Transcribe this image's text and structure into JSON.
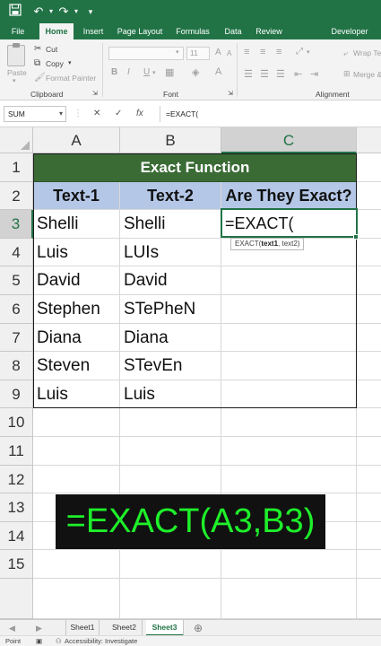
{
  "quick_access": {
    "save_icon": "save-icon",
    "undo_icon": "undo-icon",
    "redo_icon": "redo-icon"
  },
  "ribbon_tabs": [
    "File",
    "Home",
    "Insert",
    "Page Layout",
    "Formulas",
    "Data",
    "Review",
    "Developer"
  ],
  "active_tab": "Home",
  "ribbon": {
    "clipboard": {
      "paste": "Paste",
      "cut": "Cut",
      "copy": "Copy",
      "format_painter": "Format Painter",
      "label": "Clipboard"
    },
    "font": {
      "label": "Font",
      "size": "11",
      "bold": "B",
      "italic": "I",
      "underline": "U",
      "grow": "A",
      "shrink": "A"
    },
    "alignment": {
      "wrap_text": "Wrap Te",
      "merge": "Merge &",
      "label": "Alignment"
    }
  },
  "formula_bar": {
    "name_box": "SUM",
    "cancel": "✕",
    "enter": "✓",
    "fx": "fx",
    "formula": "=EXACT("
  },
  "columns": [
    "A",
    "B",
    "C"
  ],
  "rows": [
    "1",
    "2",
    "3",
    "4",
    "5",
    "6",
    "7",
    "8",
    "9",
    "10",
    "11",
    "12",
    "13",
    "14",
    "15"
  ],
  "title": "Exact Function",
  "headers": [
    "Text-1",
    "Text-2",
    "Are They Exact?"
  ],
  "data": [
    {
      "a": "Shelli",
      "b": "Shelli",
      "c": "=EXACT("
    },
    {
      "a": "Luis",
      "b": "LUIs",
      "c": ""
    },
    {
      "a": "David",
      "b": "David",
      "c": ""
    },
    {
      "a": "Stephen",
      "b": "STePheN",
      "c": ""
    },
    {
      "a": "Diana",
      "b": "Diana",
      "c": ""
    },
    {
      "a": "Steven",
      "b": "STevEn",
      "c": ""
    },
    {
      "a": "Luis",
      "b": "Luis",
      "c": ""
    }
  ],
  "tooltip": {
    "fn": "EXACT(",
    "arg1": "text1",
    "rest": ", text2)"
  },
  "banner": "=EXACT(A3,B3)",
  "sheets": [
    "Sheet1",
    "Sheet2",
    "Sheet3"
  ],
  "active_sheet": "Sheet3",
  "status": {
    "mode": "Point",
    "accessibility": "Accessibility: Investigate"
  }
}
